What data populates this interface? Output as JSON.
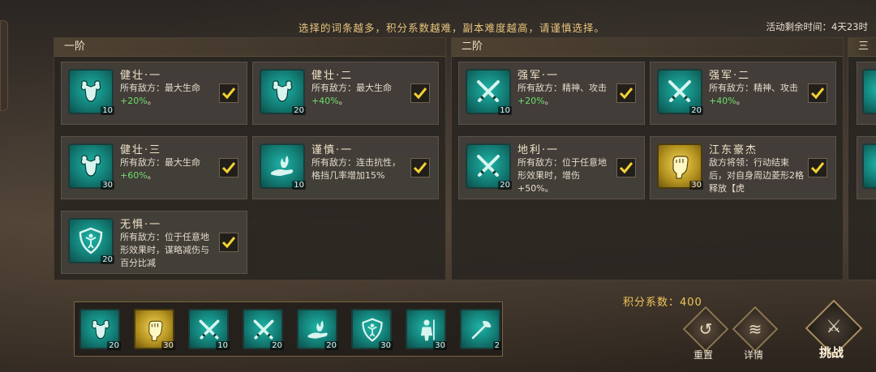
{
  "notice": "选择的词条越多，积分系数越难，副本难度越高，请谨慎选择。",
  "timer": "活动剩余时间：4天23时",
  "tiers": [
    {
      "name": "一阶"
    },
    {
      "name": "二阶"
    },
    {
      "name": "三"
    }
  ],
  "cards": [
    {
      "title": "健壮·一",
      "desc": "所有敌方：最大生命",
      "hl": "+20%",
      "tail": "。",
      "level": "10",
      "icon": "muscle-icon",
      "gold": false,
      "checked": true
    },
    {
      "title": "健壮·二",
      "desc": "所有敌方：最大生命",
      "hl": "+40%",
      "tail": "。",
      "level": "20",
      "icon": "muscle-icon",
      "gold": false,
      "checked": true
    },
    {
      "title": "健壮·三",
      "desc": "所有敌方：最大生命",
      "hl": "+60%",
      "tail": "。",
      "level": "30",
      "icon": "muscle-icon",
      "gold": false,
      "checked": true
    },
    {
      "title": "谨慎·一",
      "desc": "所有敌方：连击抗性，格挡几率增加15%",
      "hl": "",
      "tail": "",
      "level": "10",
      "icon": "hand-flame-icon",
      "gold": false,
      "checked": true
    },
    {
      "title": "无惧·一",
      "desc": "所有敌方：位于任意地形效果时，谋略减伤与百分比减",
      "hl": "",
      "tail": "",
      "level": "20",
      "icon": "shield-icon",
      "gold": false,
      "checked": true
    },
    {
      "title": "强军·一",
      "desc": "所有敌方：精神、攻击",
      "hl": "+20%",
      "tail": "。",
      "level": "10",
      "icon": "crossed-swords-icon",
      "gold": false,
      "checked": true
    },
    {
      "title": "强军·二",
      "desc": "所有敌方：精神、攻击",
      "hl": "+40%",
      "tail": "。",
      "level": "20",
      "icon": "crossed-swords-icon",
      "gold": false,
      "checked": true
    },
    {
      "title": "地利·一",
      "desc": "所有敌方：位于任意地形效果时，增伤+50%。",
      "hl": "",
      "tail": "",
      "level": "20",
      "icon": "crossed-swords-icon",
      "gold": false,
      "checked": true
    },
    {
      "title": "江东豪杰",
      "desc": "敌方将领：行动结束后，对自身周边菱形2格释放【虎",
      "hl": "",
      "tail": "",
      "level": "30",
      "icon": "fist-icon",
      "gold": true,
      "checked": true
    }
  ],
  "score_label": "积分系数：400",
  "selected": [
    {
      "icon": "muscle-icon",
      "level": "20",
      "gold": false
    },
    {
      "icon": "fist-icon",
      "level": "30",
      "gold": true
    },
    {
      "icon": "crossed-swords-icon",
      "level": "10",
      "gold": false
    },
    {
      "icon": "crossed-swords-icon",
      "level": "20",
      "gold": false
    },
    {
      "icon": "hand-flame-icon",
      "level": "20",
      "gold": false
    },
    {
      "icon": "shield-icon",
      "level": "30",
      "gold": false
    },
    {
      "icon": "warrior-icon",
      "level": "30",
      "gold": false
    },
    {
      "icon": "battle-axe-icon",
      "level": "2",
      "gold": false
    }
  ],
  "buttons": {
    "reset": "重置",
    "details": "详情",
    "challenge": "挑战"
  }
}
